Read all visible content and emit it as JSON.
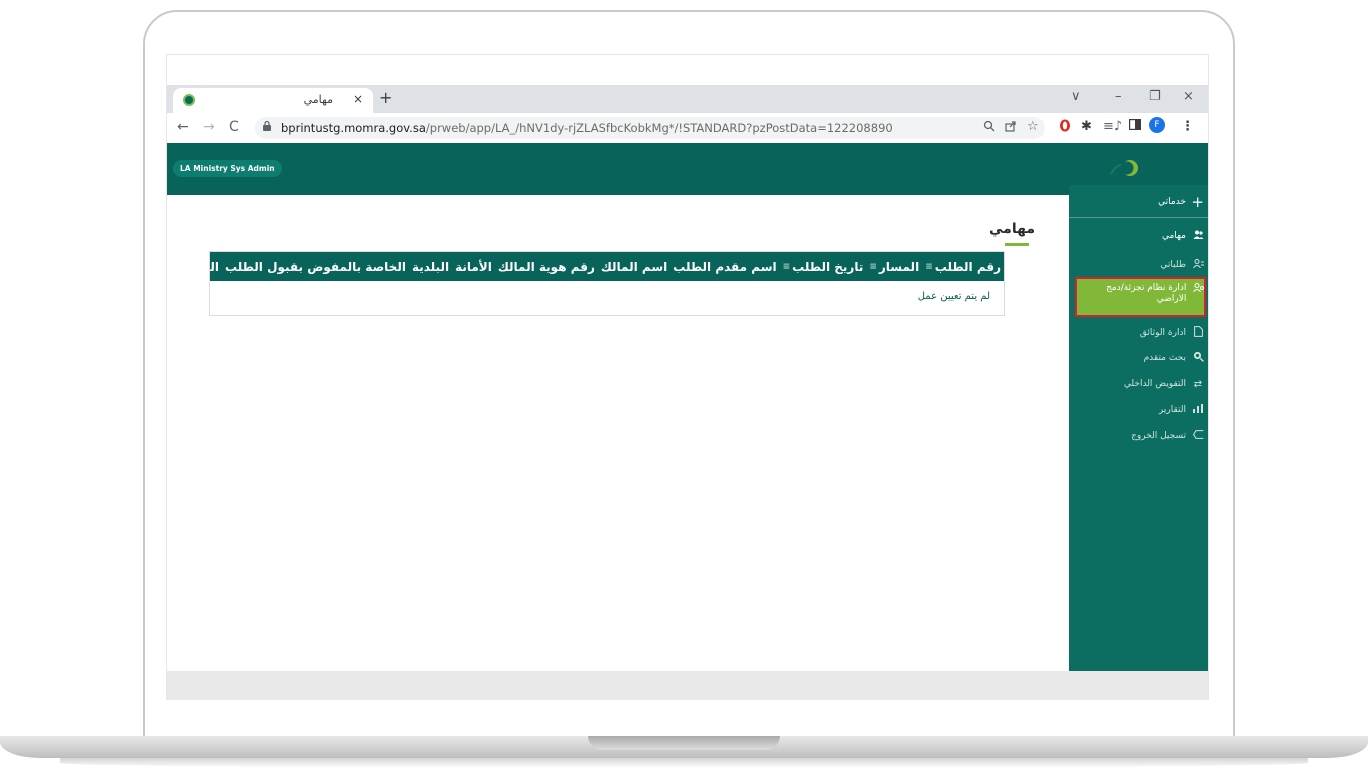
{
  "browser": {
    "tab_title": "مهامي",
    "tab_close": "×",
    "new_tab": "+",
    "url_host": "bprintustg.momra.gov.sa",
    "url_path": "/prweb/app/LA_/hNV1dy-rjZLASfbcKobkMg*/!STANDARD?pzPostData=122208890",
    "window_controls": [
      "∨",
      "–",
      "❐",
      "×"
    ],
    "nav": {
      "back": "←",
      "forward": "→",
      "reload": "C"
    },
    "extensions": [
      "zoom-icon",
      "share-icon",
      "star-icon",
      "opera-icon",
      "puzzle-icon",
      "media-icon",
      "sidebar-icon",
      "profile-icon",
      "menu-icon"
    ],
    "profile_letter": "F"
  },
  "app": {
    "user_label": "LA Ministry Sys Admin",
    "brand_color": "#08635a",
    "accent_color": "#82b83a",
    "highlight_border": "#d8202c"
  },
  "sidebar": {
    "items": [
      {
        "label": "خدماتي",
        "icon": "plus-icon"
      },
      {
        "label": "مهامي",
        "icon": "users-icon"
      },
      {
        "label": "طلباتي",
        "icon": "user-list-icon"
      },
      {
        "label": "ادارة نظام تجزئة/دمج الاراضي",
        "icon": "user-gear-icon"
      },
      {
        "label": "ادارة الوثائق",
        "icon": "document-icon"
      },
      {
        "label": "بحث متقدم",
        "icon": "search-icon"
      },
      {
        "label": "التفويض الداخلي",
        "icon": "transfer-icon"
      },
      {
        "label": "التقارير",
        "icon": "bar-chart-icon"
      },
      {
        "label": "تسجيل الخروج",
        "icon": "logout-icon"
      }
    ]
  },
  "main": {
    "title": "مهامي",
    "columns": [
      "رقم الطلب",
      "المسار",
      "تاريخ الطلب",
      "اسم مقدم الطلب",
      "اسم المالك",
      "رقم هوية المالك",
      "الأمانة",
      "البلدية",
      "الخاصة بالمفوض بقبول الطلب",
      "الحالة"
    ],
    "sortable": [
      true,
      true,
      true,
      false,
      false,
      false,
      false,
      false,
      false,
      false
    ],
    "empty_message": "لم يتم تعيين عمل"
  }
}
